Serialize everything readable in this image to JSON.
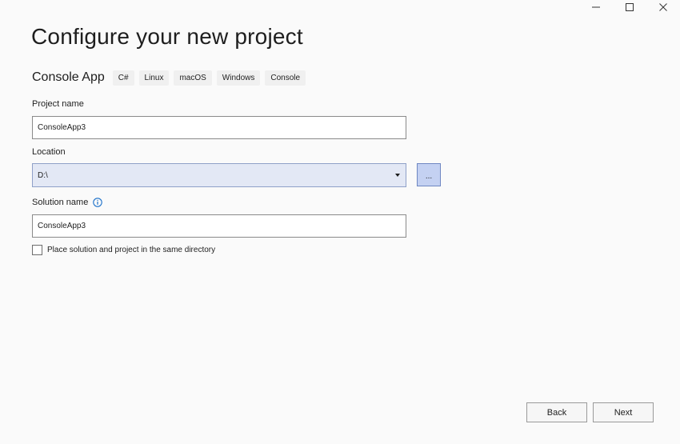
{
  "window": {
    "controls": [
      {
        "icon": "minimize-icon"
      },
      {
        "icon": "maximize-icon"
      },
      {
        "icon": "close-icon"
      }
    ]
  },
  "header": {
    "title": "Configure your new project"
  },
  "template": {
    "name": "Console App",
    "tags": [
      "C#",
      "Linux",
      "macOS",
      "Windows",
      "Console"
    ]
  },
  "form": {
    "project_name": {
      "label": "Project name",
      "value": "ConsoleApp3"
    },
    "location": {
      "label": "Location",
      "value": "D:\\",
      "browse_label": "..."
    },
    "solution_name": {
      "label": "Solution name",
      "value": "ConsoleApp3",
      "info_icon": "info-icon"
    },
    "same_directory": {
      "label": "Place solution and project in the same directory",
      "checked": false
    }
  },
  "footer": {
    "back_label": "Back",
    "next_label": "Next"
  },
  "colors": {
    "background": "#fafafa",
    "accent": "#c4d1f2",
    "info": "#1a6fc9"
  }
}
